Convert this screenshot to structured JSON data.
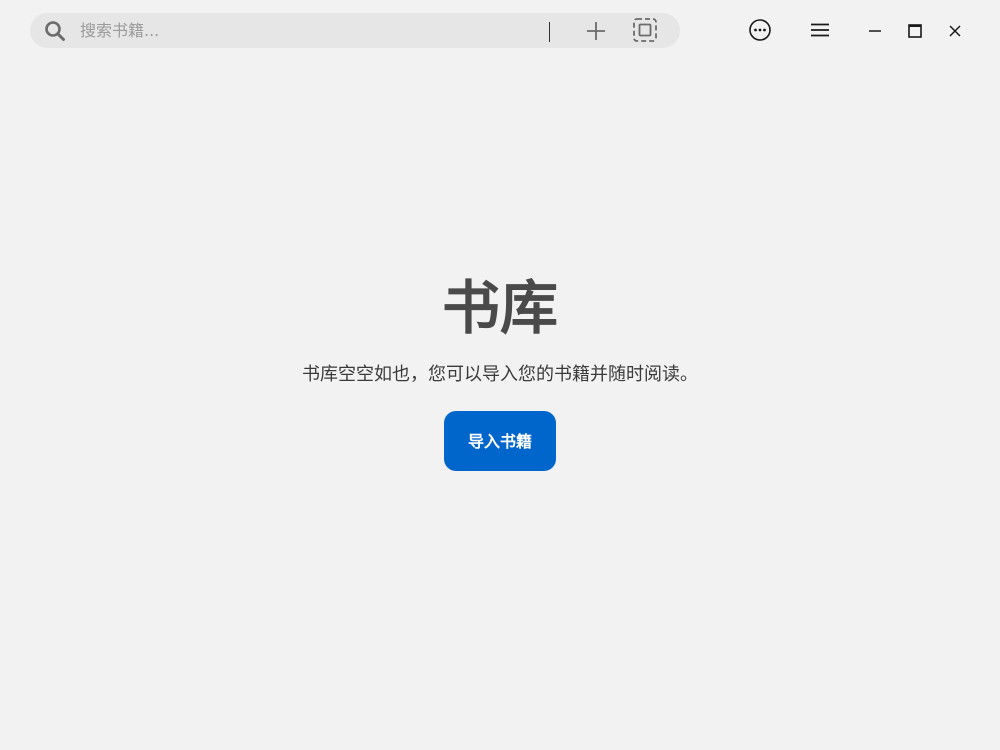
{
  "toolbar": {
    "search_placeholder": "搜索书籍...",
    "search_value": "",
    "icons": {
      "search": "search-icon",
      "add": "plus-icon",
      "scan": "scan-icon",
      "more": "more-horizontal-circle-icon",
      "menu": "hamburger-menu-icon"
    }
  },
  "window_controls": {
    "minimize": "minimize-icon",
    "maximize": "maximize-icon",
    "close": "close-icon"
  },
  "main": {
    "title": "书库",
    "description": "书库空空如也，您可以导入您的书籍并随时阅读。",
    "import_button": "导入书籍"
  },
  "colors": {
    "background": "#f2f2f2",
    "search_bg": "#e6e6e6",
    "accent": "#0066cc",
    "title": "#4a4a4a"
  }
}
